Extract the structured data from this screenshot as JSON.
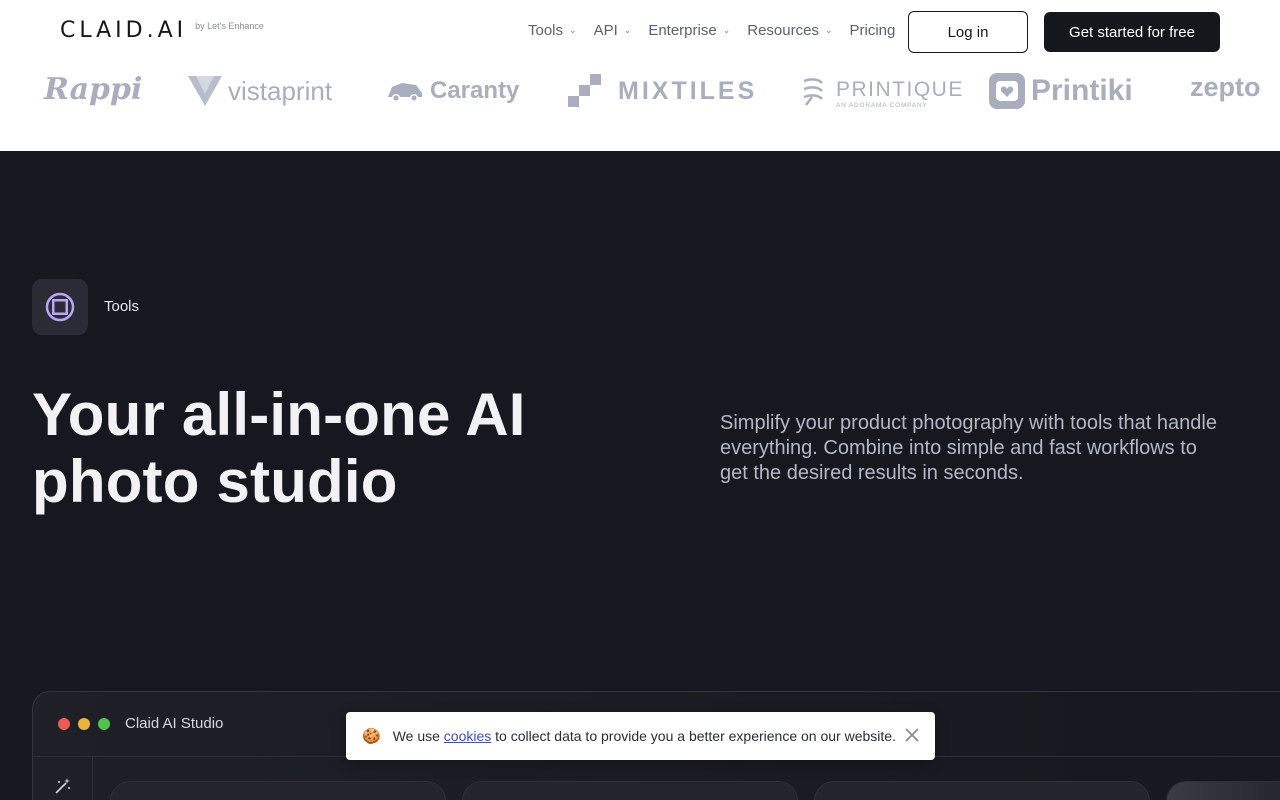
{
  "header": {
    "logo": "CLAID.AI",
    "logo_sub": "by Let's Enhance",
    "nav": [
      {
        "label": "Tools",
        "has_dropdown": true
      },
      {
        "label": "API",
        "has_dropdown": true
      },
      {
        "label": "Enterprise",
        "has_dropdown": true
      },
      {
        "label": "Resources",
        "has_dropdown": true
      },
      {
        "label": "Pricing",
        "has_dropdown": false
      }
    ],
    "login_label": "Log in",
    "cta_label": "Get started for free"
  },
  "partners": [
    "Rappi",
    "vistaprint",
    "Caranty",
    "MIXTILES",
    "PRINTIQUE",
    "AN ADORAMA COMPANY",
    "Printiki",
    "zepto"
  ],
  "hero": {
    "badge_label": "Tools",
    "title_line1": "Your all-in-one AI",
    "title_line2": "photo studio",
    "description": "Simplify your product photography with tools that handle everything. Combine into simple and fast workflows to get the desired results in seconds."
  },
  "studio": {
    "title": "Claid AI Studio"
  },
  "cookie": {
    "emoji": "🍪",
    "text_before": "We use ",
    "link": "cookies",
    "text_after": " to collect data to provide you a better experience on our website."
  },
  "colors": {
    "dark_bg": "#17181f",
    "accent_purple": "#b9a6f5",
    "primary_button": "#16171d",
    "link": "#3d4bd1"
  }
}
